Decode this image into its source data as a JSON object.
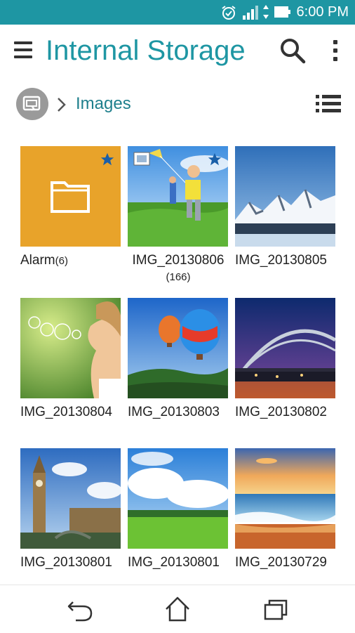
{
  "status_bar": {
    "time": "6:00 PM",
    "icons": [
      "alarm-icon",
      "signal-icon",
      "data-arrows-icon",
      "battery-icon"
    ],
    "color": "#1e96a3"
  },
  "app_bar": {
    "title": "Internal Storage",
    "icons": [
      "menu-icon",
      "search-icon",
      "more-vert-icon"
    ],
    "accent_color": "#1e96a3"
  },
  "breadcrumb": {
    "root_icon": "storage-swap-icon",
    "separator_icon": "chevron-right-icon",
    "current": "Images",
    "view_toggle_icon": "list-view-icon"
  },
  "items": [
    {
      "name": "Alarm",
      "count": "(6)",
      "kind": "folder",
      "starred": true,
      "folder_color": "#e8a32a"
    },
    {
      "name": "IMG_20130806",
      "count": "(166)",
      "kind": "image-kite",
      "starred": true
    },
    {
      "name": "IMG_20130805",
      "count": "",
      "kind": "image-mountains",
      "starred": false
    },
    {
      "name": "IMG_20130804",
      "count": "",
      "kind": "image-bubbles",
      "starred": false
    },
    {
      "name": "IMG_20130803",
      "count": "",
      "kind": "image-balloons",
      "starred": false
    },
    {
      "name": "IMG_20130802",
      "count": "",
      "kind": "image-bridge",
      "starred": false
    },
    {
      "name": "IMG_20130801",
      "count": "",
      "kind": "image-bigben",
      "starred": false
    },
    {
      "name": "IMG_20130801",
      "count": "",
      "kind": "image-meadow",
      "starred": false
    },
    {
      "name": "IMG_20130729",
      "count": "",
      "kind": "image-beach",
      "starred": false
    }
  ],
  "nav_bar": {
    "icons": [
      "back-icon",
      "home-icon",
      "recent-apps-icon"
    ]
  }
}
